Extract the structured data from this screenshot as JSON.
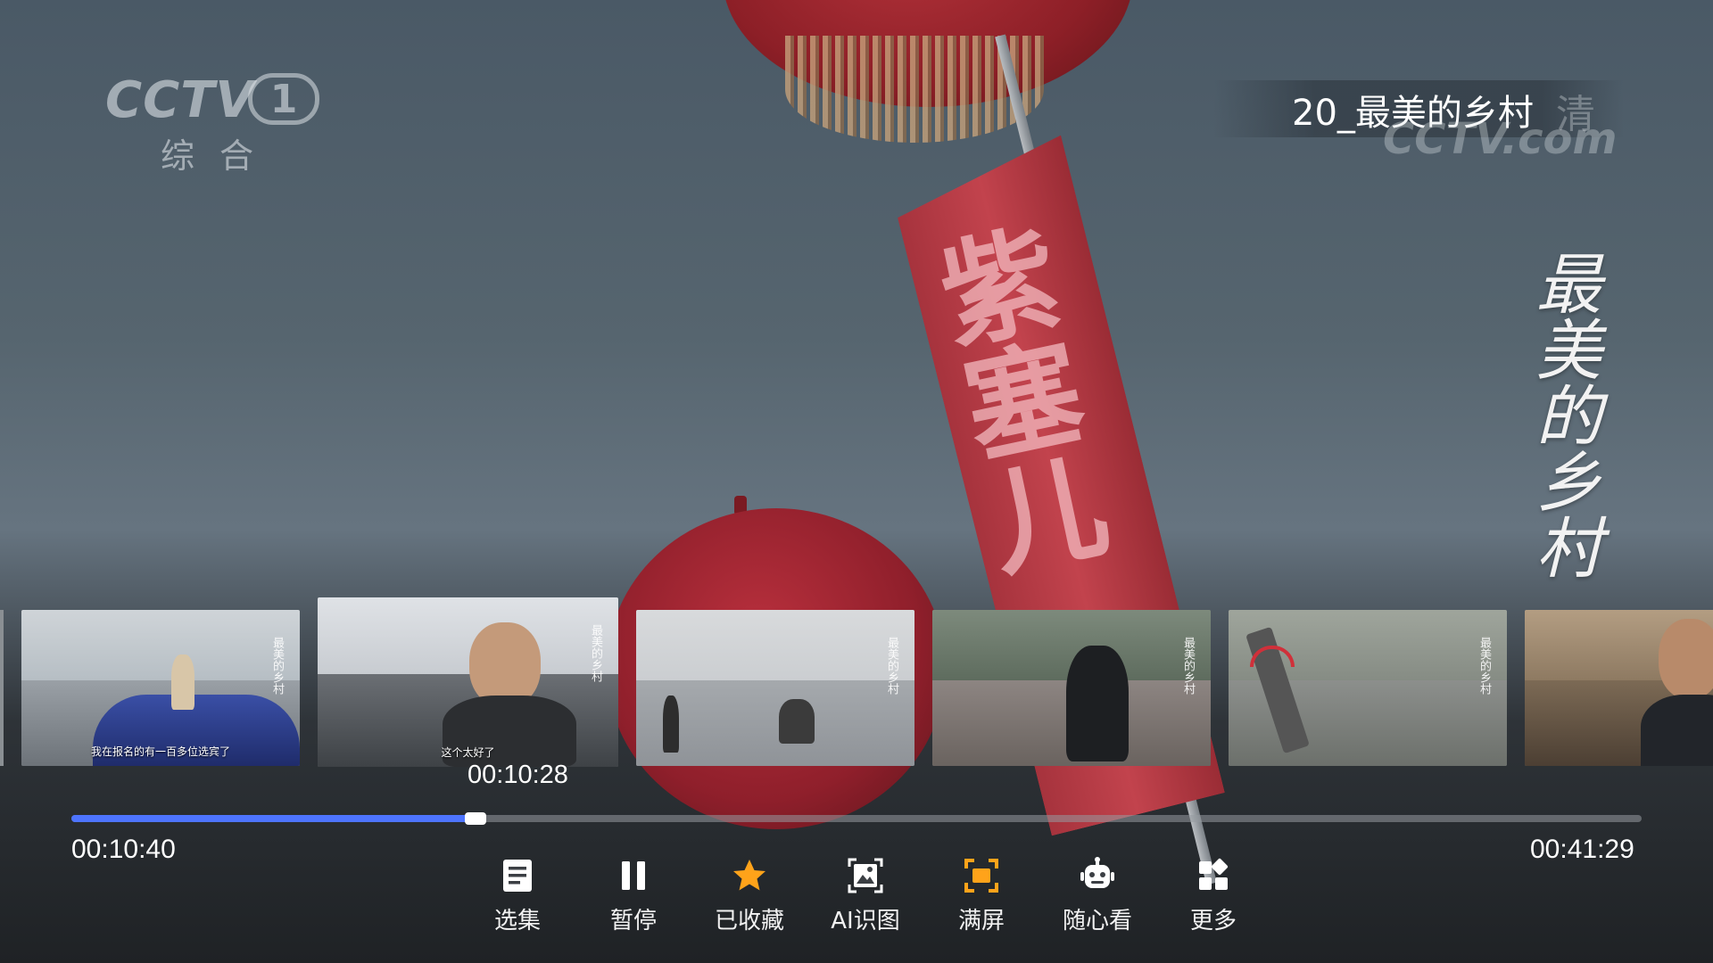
{
  "video": {
    "title": "20_最美的乡村",
    "side_title": "最美的乡村",
    "banner_text": "紫塞儿",
    "current_time": "00:10:40",
    "total_time": "00:41:29",
    "preview_time": "00:10:28",
    "progress_fraction": 0.2576
  },
  "channel": {
    "brand": "CCTV",
    "number": "1",
    "name": "综合"
  },
  "watermark": {
    "hd": "清",
    "site": "CCTV.com"
  },
  "thumbnails": [
    {
      "subtitle": "我在报名的有一百多位选宾了",
      "side_label": "最美的乡村"
    },
    {
      "subtitle": "这个太好了",
      "side_label": "最美的乡村"
    },
    {
      "subtitle": "",
      "side_label": "最美的乡村"
    },
    {
      "subtitle": "",
      "side_label": "最美的乡村"
    },
    {
      "subtitle": "",
      "side_label": "最美的乡村"
    },
    {
      "subtitle": "",
      "side_label": ""
    }
  ],
  "controls": [
    {
      "label": "选集",
      "icon": "episode-list-icon",
      "color": "#ffffff"
    },
    {
      "label": "暂停",
      "icon": "pause-icon",
      "color": "#ffffff"
    },
    {
      "label": "已收藏",
      "icon": "star-icon",
      "color": "#ffa31a"
    },
    {
      "label": "AI识图",
      "icon": "image-recognition-icon",
      "color": "#ffffff"
    },
    {
      "label": "满屏",
      "icon": "fullscreen-icon",
      "color": "#ffa31a"
    },
    {
      "label": "随心看",
      "icon": "robot-icon",
      "color": "#ffffff"
    },
    {
      "label": "更多",
      "icon": "more-grid-icon",
      "color": "#ffffff"
    }
  ],
  "colors": {
    "progress": "#4d74ff",
    "accent": "#ffa31a"
  }
}
